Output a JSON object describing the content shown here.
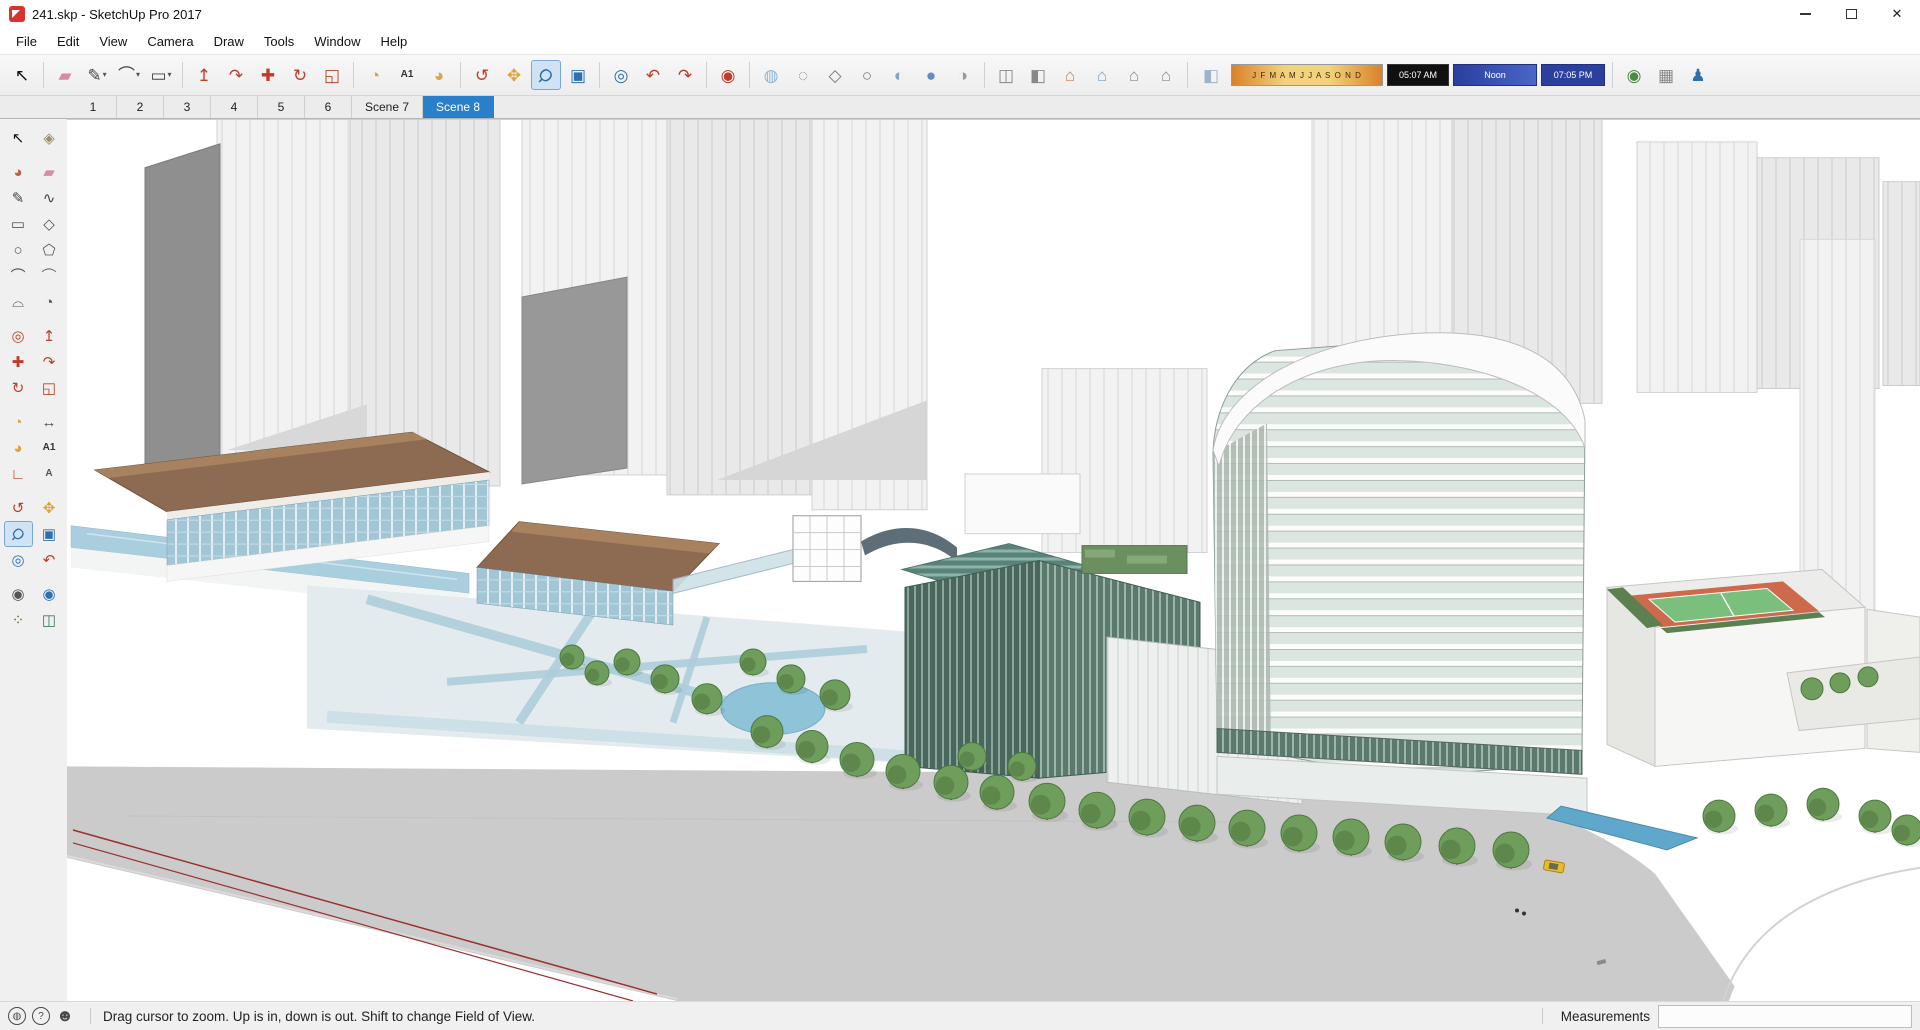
{
  "window": {
    "title": "241.skp - SketchUp Pro 2017",
    "controls": [
      {
        "name": "minimize-button",
        "kind": "mini"
      },
      {
        "name": "maximize-button",
        "kind": "maxi"
      },
      {
        "name": "close-button",
        "kind": "clo",
        "glyph": "✕"
      }
    ]
  },
  "menu": {
    "items": [
      "File",
      "Edit",
      "View",
      "Camera",
      "Draw",
      "Tools",
      "Window",
      "Help"
    ]
  },
  "toolbar": {
    "groups": [
      {
        "items": [
          {
            "name": "select",
            "glyph": "↖",
            "color": "#111111"
          }
        ]
      },
      {
        "items": [
          {
            "name": "eraser",
            "glyph": "▰",
            "color": "#d98aa4"
          },
          {
            "name": "line",
            "glyph": "✎",
            "color": "#444444",
            "dropdown": true
          },
          {
            "name": "arc",
            "glyph": "⌒",
            "color": "#444444",
            "dropdown": true
          },
          {
            "name": "shapes",
            "glyph": "▭",
            "color": "#444444",
            "dropdown": true
          }
        ]
      },
      {
        "items": [
          {
            "name": "push-pull",
            "glyph": "↥",
            "color": "#b5442d"
          },
          {
            "name": "follow-me",
            "glyph": "↷",
            "color": "#b5442d"
          },
          {
            "name": "move",
            "glyph": "✚",
            "color": "#c23b2a"
          },
          {
            "name": "rotate",
            "glyph": "↻",
            "color": "#c23b2a"
          },
          {
            "name": "scale",
            "glyph": "◱",
            "color": "#b5442d"
          }
        ]
      },
      {
        "items": [
          {
            "name": "tape-measure",
            "glyph": "◔",
            "color": "#d9a441"
          },
          {
            "name": "text",
            "glyph": "A1",
            "color": "#333333",
            "text": true
          },
          {
            "name": "protractor",
            "glyph": "◕",
            "color": "#d9a441"
          }
        ]
      },
      {
        "items": [
          {
            "name": "orbit",
            "glyph": "↺",
            "color": "#c23b2a"
          },
          {
            "name": "pan",
            "glyph": "✥",
            "color": "#d9a441"
          },
          {
            "name": "zoom",
            "glyph": "Ϙ",
            "color": "#2f6fae",
            "active": true,
            "rot": true
          },
          {
            "name": "zoom-window",
            "glyph": "▣",
            "color": "#2f6fae"
          }
        ]
      },
      {
        "items": [
          {
            "name": "zoom-extents",
            "glyph": "◎",
            "color": "#2f6fae"
          },
          {
            "name": "previous",
            "glyph": "↶",
            "color": "#c23b2a"
          },
          {
            "name": "next",
            "glyph": "↷",
            "color": "#c23b2a"
          }
        ]
      },
      {
        "items": [
          {
            "name": "position-camera",
            "glyph": "◉",
            "color": "#c23b2a"
          }
        ]
      },
      {
        "items": [
          {
            "name": "x-ray",
            "glyph": "◍",
            "color": "#8fb6d9"
          },
          {
            "name": "back-edges",
            "glyph": "◌",
            "color": "#888888"
          },
          {
            "name": "wireframe",
            "glyph": "◇",
            "color": "#777777"
          },
          {
            "name": "hidden-line",
            "glyph": "○",
            "color": "#777777"
          },
          {
            "name": "shaded",
            "glyph": "◐",
            "color": "#79a8c9"
          },
          {
            "name": "shaded-with-textures",
            "glyph": "●",
            "color": "#5b8ec4"
          },
          {
            "name": "monochrome",
            "glyph": "◑",
            "color": "#9a9a9a"
          }
        ]
      },
      {
        "items": [
          {
            "name": "section-plane",
            "glyph": "◫",
            "color": "#888888"
          },
          {
            "name": "section-cuts",
            "glyph": "◧",
            "color": "#888888"
          },
          {
            "name": "iso-view",
            "glyph": "⌂",
            "color": "#c77f4a"
          },
          {
            "name": "top-view",
            "glyph": "⌂",
            "color": "#7f9cc7"
          },
          {
            "name": "front-view",
            "glyph": "⌂",
            "color": "#8a8a8a"
          },
          {
            "name": "right-view",
            "glyph": "⌂",
            "color": "#8a8a8a"
          }
        ]
      },
      {
        "type": "shadow",
        "toggle": {
          "name": "shadows-toggle",
          "glyph": "◧",
          "color": "#9fb3c8"
        }
      },
      {
        "items": [
          {
            "name": "add-location",
            "glyph": "◉",
            "color": "#4a8c3f"
          },
          {
            "name": "photo-textures",
            "glyph": "▦",
            "color": "#888888"
          },
          {
            "name": "warehouse-person",
            "glyph": "♟",
            "color": "#2f6fae"
          }
        ]
      }
    ],
    "shadow": {
      "months": "J F M A M J J A S O N D",
      "time_start": "05:07 AM",
      "noon_label": "Noon",
      "time_end": "07:05 PM"
    }
  },
  "scene_tabs": {
    "tabs": [
      {
        "label": "1"
      },
      {
        "label": "2"
      },
      {
        "label": "3"
      },
      {
        "label": "4"
      },
      {
        "label": "5"
      },
      {
        "label": "6"
      },
      {
        "label": "Scene 7"
      },
      {
        "label": "Scene 8",
        "active": true
      }
    ]
  },
  "left_toolbar": {
    "items": [
      {
        "name": "select",
        "glyph": "↖",
        "color": "#111111"
      },
      {
        "name": "make-component",
        "glyph": "◈",
        "color": "#9a8f6a"
      },
      {
        "name": "paint-bucket",
        "glyph": "◕",
        "color": "#c0603a",
        "gap": true
      },
      {
        "name": "eraser",
        "glyph": "▰",
        "color": "#d98aa4"
      },
      {
        "name": "line",
        "glyph": "✎",
        "color": "#444444"
      },
      {
        "name": "freehand",
        "glyph": "∿",
        "color": "#444444"
      },
      {
        "name": "rectangle",
        "glyph": "▭",
        "color": "#555555"
      },
      {
        "name": "rotated-rectangle",
        "glyph": "◇",
        "color": "#555555"
      },
      {
        "name": "circle",
        "glyph": "○",
        "color": "#555555"
      },
      {
        "name": "polygon",
        "glyph": "⬠",
        "color": "#555555"
      },
      {
        "name": "arc",
        "glyph": "⌒",
        "color": "#555555"
      },
      {
        "name": "two-point-arc",
        "glyph": "⌒",
        "color": "#777777"
      },
      {
        "name": "three-point-arc",
        "glyph": "⌓",
        "color": "#555555"
      },
      {
        "name": "pie",
        "glyph": "◔",
        "color": "#555555"
      },
      {
        "name": "offset",
        "glyph": "◎",
        "color": "#b5442d",
        "gap": true
      },
      {
        "name": "push-pull",
        "glyph": "↥",
        "color": "#b5442d"
      },
      {
        "name": "move",
        "glyph": "✚",
        "color": "#c23b2a"
      },
      {
        "name": "follow-me",
        "glyph": "↷",
        "color": "#b5442d"
      },
      {
        "name": "rotate",
        "glyph": "↻",
        "color": "#c23b2a"
      },
      {
        "name": "scale",
        "glyph": "◱",
        "color": "#b5442d"
      },
      {
        "name": "tape-measure",
        "glyph": "◔",
        "color": "#d9a441",
        "gap": true
      },
      {
        "name": "dimensions",
        "glyph": "↔",
        "color": "#555555"
      },
      {
        "name": "protractor",
        "glyph": "◕",
        "color": "#d9a441"
      },
      {
        "name": "text",
        "glyph": "A1",
        "color": "#333333",
        "text": true
      },
      {
        "name": "axes",
        "glyph": "∟",
        "color": "#c23b2a"
      },
      {
        "name": "3d-text",
        "glyph": "A",
        "color": "#555555",
        "text": true
      },
      {
        "name": "orbit",
        "glyph": "↺",
        "color": "#c23b2a",
        "gap": true
      },
      {
        "name": "pan",
        "glyph": "✥",
        "color": "#d9a441"
      },
      {
        "name": "zoom",
        "glyph": "Ϙ",
        "color": "#2f6fae",
        "active": true,
        "rot": true
      },
      {
        "name": "zoom-window",
        "glyph": "▣",
        "color": "#2f6fae"
      },
      {
        "name": "zoom-extents",
        "glyph": "◎",
        "color": "#2f6fae"
      },
      {
        "name": "previous",
        "glyph": "↶",
        "color": "#c23b2a"
      },
      {
        "name": "position-camera",
        "glyph": "◉",
        "color": "#555555",
        "gap": true
      },
      {
        "name": "look-around",
        "glyph": "◉",
        "color": "#2f6fae"
      },
      {
        "name": "walk",
        "glyph": "⁘",
        "color": "#7a5c3a"
      },
      {
        "name": "section-plane",
        "glyph": "◫",
        "color": "#3a7d5a"
      }
    ]
  },
  "statusbar": {
    "icons": [
      {
        "name": "geolocation-icon",
        "glyph": "◍"
      },
      {
        "name": "credits-icon",
        "glyph": "?"
      },
      {
        "name": "user-icon",
        "glyph": "☻",
        "person": true
      }
    ],
    "message": "Drag cursor to zoom.  Up is in, down is out. Shift to change Field of View.",
    "measurements_label": "Measurements",
    "measurements_value": ""
  }
}
